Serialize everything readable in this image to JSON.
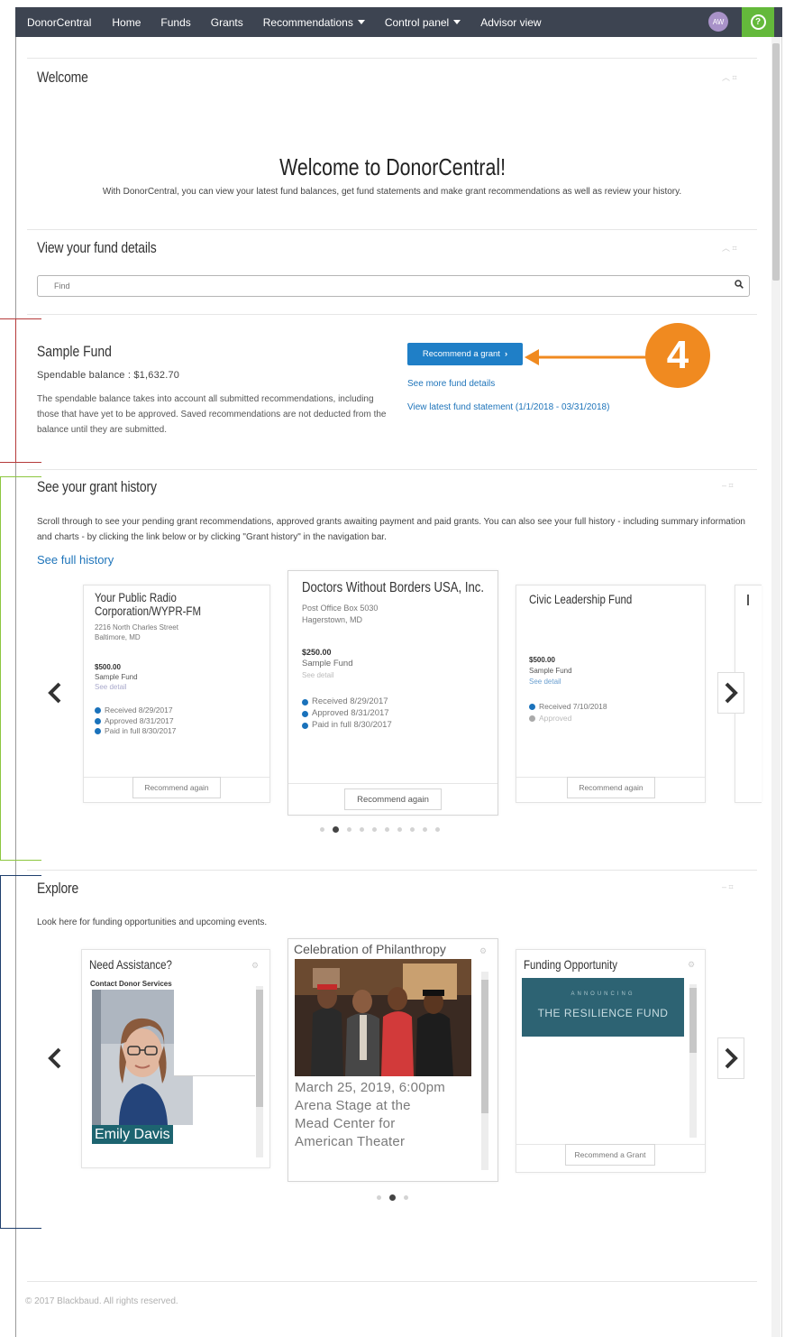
{
  "nav": {
    "brand": "DonorCentral",
    "items": [
      "Home",
      "Funds",
      "Grants",
      "Recommendations",
      "Control panel",
      "Advisor view"
    ],
    "avatar_initials": "AW",
    "help_label": "?"
  },
  "welcome": {
    "section_title": "Welcome",
    "heading": "Welcome to DonorCentral!",
    "text": "With DonorCentral, you can view your latest fund balances, get fund statements and make grant recommendations as well as review your history."
  },
  "fund_details": {
    "section_title": "View your fund details",
    "search_placeholder": "Find"
  },
  "fund": {
    "name": "Sample Fund",
    "balance_label": "Spendable balance : $1,632.70",
    "description": "The spendable balance takes into account all submitted recommendations, including those that have yet to be approved. Saved recommendations are not deducted from the balance until they are submitted.",
    "recommend_button": "Recommend a grant",
    "see_more_link": "See more fund details",
    "statement_link": "View latest fund statement (1/1/2018 - 03/31/2018)",
    "callout_number": "4"
  },
  "grant_history": {
    "section_title": "See your grant history",
    "description": "Scroll through to see your pending grant recommendations, approved grants awaiting payment and paid grants. You can also see your full history - including summary information and charts - by clicking the link below or by clicking \"Grant history\" in the navigation bar.",
    "full_history_link": "See full history",
    "cards": [
      {
        "title_lines": [
          "Your Public Radio",
          "Corporation/WYPR-FM"
        ],
        "address_lines": [
          "2216 North Charles Street",
          "Baltimore, MD"
        ],
        "amount": "$500.00",
        "fund": "Sample Fund",
        "detail": "See detail",
        "statuses": [
          "Received 8/29/2017",
          "Approved 8/31/2017",
          "Paid in full 8/30/2017"
        ],
        "button": "Recommend again"
      },
      {
        "title_lines": [
          "Doctors Without Borders USA, Inc."
        ],
        "address_lines": [
          "Post Office Box 5030",
          "Hagerstown, MD"
        ],
        "amount": "$250.00",
        "fund": "Sample Fund",
        "detail": "See detail",
        "statuses": [
          "Received 8/29/2017",
          "Approved 8/31/2017",
          "Paid in full 8/30/2017"
        ],
        "button": "Recommend again"
      },
      {
        "title_lines": [
          "Civic Leadership Fund"
        ],
        "address_lines": [],
        "amount": "$500.00",
        "fund": "Sample Fund",
        "detail": "See detail",
        "statuses": [
          "Received 7/10/2018",
          "Approved"
        ],
        "button": "Recommend again"
      }
    ],
    "page_count": 10,
    "active_page": 2
  },
  "explore": {
    "section_title": "Explore",
    "description": "Look here for funding opportunities and upcoming events.",
    "cards": [
      {
        "title": "Need Assistance?",
        "subtitle": "Contact Donor Services",
        "person_name": "Emily Davis"
      },
      {
        "title": "Celebration of Philanthropy",
        "caption_lines": [
          "March 25, 2019, 6:00pm",
          "Arena Stage at the",
          "Mead Center for",
          "American Theater"
        ]
      },
      {
        "title": "Funding Opportunity",
        "banner_small": "ANNOUNCING",
        "banner_big": "THE RESILIENCE FUND",
        "button": "Recommend a Grant"
      }
    ],
    "page_count": 3,
    "active_page": 2
  },
  "footer": {
    "copyright": "© 2017 Blackbaud. All rights reserved."
  },
  "colors": {
    "navbar": "#3d4451",
    "accent_blue": "#1f7fc7",
    "callout_orange": "#f08a20",
    "help_green": "#64b93b",
    "bracket_red": "#b53a3a",
    "bracket_green": "#8cc63f",
    "bracket_navy": "#1f3f6e"
  }
}
